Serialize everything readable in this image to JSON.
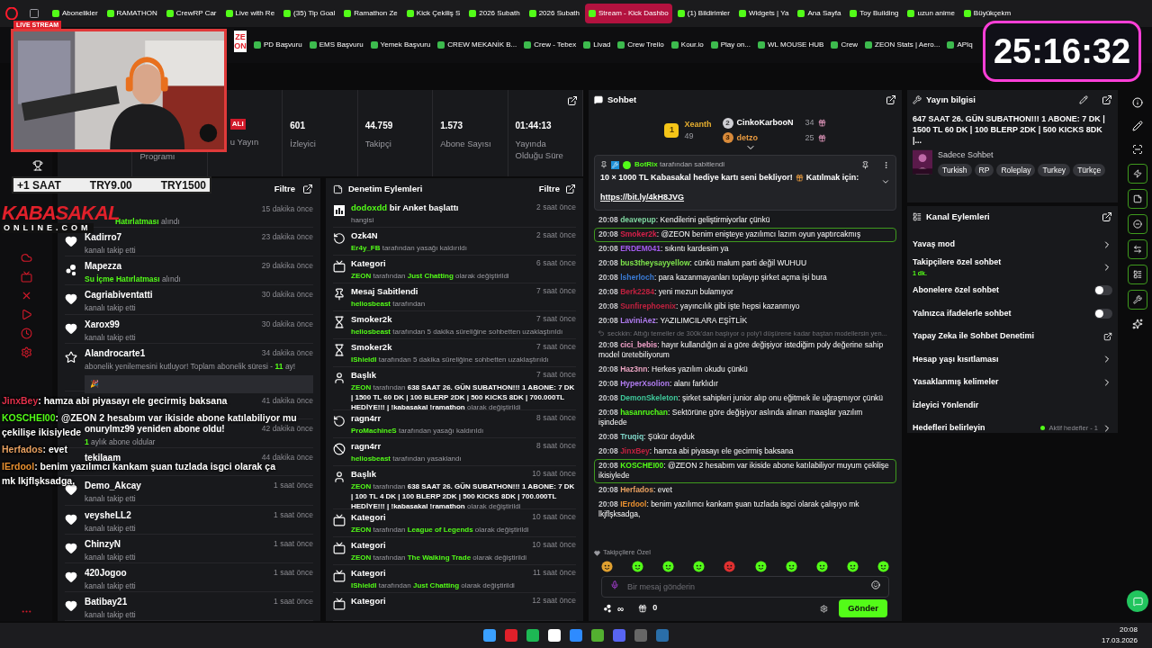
{
  "browser": {
    "tabs": [
      {
        "label": "Abonelikler",
        "selected": false
      },
      {
        "label": "RAMATHON",
        "selected": false
      },
      {
        "label": "CrewRP Car",
        "selected": false
      },
      {
        "label": "Live with Re",
        "selected": false
      },
      {
        "label": "(35) Tip Goal",
        "selected": false
      },
      {
        "label": "Ramathon Ze",
        "selected": false
      },
      {
        "label": "Kick Çekiliş S",
        "selected": false
      },
      {
        "label": "2026 Subath",
        "selected": false
      },
      {
        "label": "2026 Subath",
        "selected": false
      },
      {
        "label": "Stream - Kick Dashbo",
        "selected": true
      },
      {
        "label": "(1) Bildirimler",
        "selected": false
      },
      {
        "label": "Widgets | Ya",
        "selected": false
      },
      {
        "label": "Ana Sayfa",
        "selected": false
      },
      {
        "label": "Toy Building",
        "selected": false
      },
      {
        "label": "uzun anime",
        "selected": false
      },
      {
        "label": "Büyükçekm",
        "selected": false
      }
    ],
    "bookmarks": [
      "PD Başvuru",
      "EMS Başvuru",
      "Yemek Başvuru",
      "CREW MEKANİK B...",
      "Crew - Tebex",
      "Livad",
      "Crew Trello",
      "Kour.io",
      "Play on...",
      "WL MOUSE HUB",
      "Crew",
      "ZEON Stats | Aero...",
      "APIq"
    ]
  },
  "overlay": {
    "camera_badge": "LIVE STREAM",
    "camera_side_text": "ZEON",
    "timer": "25:16:32",
    "ticker": [
      "+1 SAAT",
      "TRY9.00",
      "TRY1500"
    ],
    "logo_top": "KABASAKAL",
    "logo_bottom": "ONLINE.COM",
    "chat": [
      {
        "user": "JinxBey",
        "color": "#e0304a",
        "lines": [
          ": hamza abi piyasayı ele gecirmiş baksana"
        ]
      },
      {
        "user": "KOSCHEI00",
        "color": "#53fc18",
        "lines": [
          ": @ZEON 2 hesabım var ikiside abone katılabiliyor mu",
          "çekilişe ikisiylede"
        ]
      },
      {
        "user": "Herfados",
        "color": "#e8a060",
        "lines": [
          ": evet"
        ]
      },
      {
        "user": "IErdool",
        "color": "#e89030",
        "lines": [
          ": benim yazılımcı kankam şuan tuzlada isgci olarak ça",
          "mk lkjflşksadga,"
        ]
      }
    ]
  },
  "stats": [
    {
      "label": "Programı"
    },
    {
      "badge": "ALI",
      "label": "u Yayın"
    },
    {
      "value": "601",
      "label": "İzleyici"
    },
    {
      "value": "44.759",
      "label": "Takipçi"
    },
    {
      "value": "1.573",
      "label": "Abone Sayısı"
    },
    {
      "value": "01:44:13",
      "label": "Yayında Olduğu Süre"
    }
  ],
  "activity": {
    "filter": "Filtre",
    "items": [
      {
        "time": "15 dakika önce",
        "text": [
          {
            "text": "Hatırlatması",
            "kind": "user"
          },
          {
            "text": " alındı",
            "kind": "plain"
          }
        ]
      },
      {
        "kind": "follow",
        "name": "Kadirro7",
        "time": "23 dakika önce",
        "text": [
          {
            "text": "kanalı takip etti",
            "kind": "plain"
          }
        ]
      },
      {
        "kind": "points",
        "name": "Mapezza",
        "time": "29 dakika önce",
        "text": [
          {
            "text": "Su İçme Hatırlatması",
            "kind": "user"
          },
          {
            "text": " alındı",
            "kind": "plain"
          }
        ]
      },
      {
        "kind": "follow",
        "name": "Cagriabiventatti",
        "time": "30 dakika önce",
        "text": [
          {
            "text": "kanalı takip etti",
            "kind": "plain"
          }
        ]
      },
      {
        "kind": "follow",
        "name": "Xarox99",
        "time": "30 dakika önce",
        "text": [
          {
            "text": "kanalı takip etti",
            "kind": "plain"
          }
        ]
      },
      {
        "kind": "resub",
        "name": "Alandrocarte1",
        "time": "34 dakika önce",
        "text": [
          {
            "text": "abonelik yenilemesini kutluyor! Toplam abonelik süresi - ",
            "kind": "plain"
          },
          {
            "text": "11",
            "kind": "user"
          },
          {
            "text": " ay!",
            "kind": "plain"
          }
        ],
        "message": "🎉"
      },
      {
        "time": "41 dakika önce"
      },
      {
        "time": "42 dakika önce",
        "name": "onurylmz99 yeniden abone oldu!",
        "text": [
          {
            "text": "1",
            "kind": "user"
          },
          {
            "text": " aylık abone oldular",
            "kind": "plain"
          }
        ]
      },
      {
        "name": "tekilaam",
        "time": "44 dakika önce"
      },
      {
        "kind": "follow",
        "name": "Demo_Akcay",
        "time": "1 saat önce",
        "text": [
          {
            "text": "kanalı takip etti",
            "kind": "plain"
          }
        ]
      },
      {
        "kind": "follow",
        "name": "veysheLL2",
        "time": "1 saat önce",
        "text": [
          {
            "text": "kanalı takip etti",
            "kind": "plain"
          }
        ]
      },
      {
        "kind": "follow",
        "name": "ChinzyN",
        "time": "1 saat önce",
        "text": [
          {
            "text": "kanalı takip etti",
            "kind": "plain"
          }
        ]
      },
      {
        "kind": "follow",
        "name": "420Jogoo",
        "time": "1 saat önce",
        "text": [
          {
            "text": "kanalı takip etti",
            "kind": "plain"
          }
        ]
      },
      {
        "kind": "follow",
        "name": "Batibay21",
        "time": "1 saat önce",
        "text": [
          {
            "text": "kanalı takip etti",
            "kind": "plain"
          }
        ]
      }
    ]
  },
  "moderation": {
    "title": "Denetim Eylemleri",
    "filter": "Filtre",
    "items": [
      {
        "kind": "poll",
        "title": [
          {
            "text": "dodoxdd",
            "kind": "user"
          },
          {
            "text": " bir Anket başlattı",
            "kind": "bold"
          }
        ],
        "time": "2 saat önce",
        "text": [
          {
            "text": "hangisi",
            "kind": "plain"
          }
        ]
      },
      {
        "kind": "unban",
        "title": [
          {
            "text": "Ozk4N",
            "kind": "bold"
          }
        ],
        "time": "2 saat önce",
        "text": [
          {
            "text": "Er4y_FB",
            "kind": "user"
          },
          {
            "text": " tarafından yasağı kaldırıldı",
            "kind": "plain"
          }
        ]
      },
      {
        "kind": "category",
        "title": [
          {
            "text": "Kategori",
            "kind": "bold"
          }
        ],
        "time": "6 saat önce",
        "text": [
          {
            "text": "ZEON",
            "kind": "user"
          },
          {
            "text": " tarafından ",
            "kind": "plain"
          },
          {
            "text": "Just Chatting",
            "kind": "user"
          },
          {
            "text": " olarak değiştirildi",
            "kind": "plain"
          }
        ]
      },
      {
        "kind": "pin",
        "title": [
          {
            "text": "Mesaj Sabitlendi",
            "kind": "bold"
          }
        ],
        "time": "7 saat önce",
        "text": [
          {
            "text": "heliosbeast",
            "kind": "user"
          },
          {
            "text": " tarafından",
            "kind": "plain"
          }
        ]
      },
      {
        "kind": "timeout",
        "title": [
          {
            "text": "Smoker2k",
            "kind": "bold"
          }
        ],
        "time": "7 saat önce",
        "text": [
          {
            "text": "heliosbeast",
            "kind": "user"
          },
          {
            "text": " tarafından 5 dakika süreliğine sohbetten uzaklaştırıldı",
            "kind": "plain"
          }
        ]
      },
      {
        "kind": "timeout",
        "title": [
          {
            "text": "Smoker2k",
            "kind": "bold"
          }
        ],
        "time": "7 saat önce",
        "text": [
          {
            "text": "IShieldI",
            "kind": "user"
          },
          {
            "text": " tarafından 5 dakika süreliğine sohbetten uzaklaştırıldı",
            "kind": "plain"
          }
        ]
      },
      {
        "kind": "title",
        "title": [
          {
            "text": "Başlık",
            "kind": "bold"
          }
        ],
        "time": "7 saat önce",
        "text": [
          {
            "text": "ZEON",
            "kind": "user"
          },
          {
            "text": " tarafından ",
            "kind": "plain"
          },
          {
            "text": "638 SAAT 26. GÜN SUBATHON!!! 1 ABONE: 7 DK | 1500 TL 60 DK | 100 BLERP 2DK | 500 KICKS 8DK | 700.000TL HEDİYE!!! | !kabasakal !ramathon",
            "kind": "bold"
          },
          {
            "text": " olarak değiştirildi",
            "kind": "plain"
          }
        ]
      },
      {
        "kind": "unban",
        "title": [
          {
            "text": "ragn4rr",
            "kind": "bold"
          }
        ],
        "time": "8 saat önce",
        "text": [
          {
            "text": "ProMachineS",
            "kind": "user"
          },
          {
            "text": " tarafından yasağı kaldırıldı",
            "kind": "plain"
          }
        ]
      },
      {
        "kind": "ban",
        "title": [
          {
            "text": "ragn4rr",
            "kind": "bold"
          }
        ],
        "time": "8 saat önce",
        "text": [
          {
            "text": "heliosbeast",
            "kind": "user"
          },
          {
            "text": " tarafından yasaklandı",
            "kind": "plain"
          }
        ]
      },
      {
        "kind": "title",
        "title": [
          {
            "text": "Başlık",
            "kind": "bold"
          }
        ],
        "time": "10 saat önce",
        "text": [
          {
            "text": "ZEON",
            "kind": "user"
          },
          {
            "text": " tarafından ",
            "kind": "plain"
          },
          {
            "text": "638 SAAT 26. GÜN SUBATHON!!! 1 ABONE: 7 DK | 100 TL 4 DK | 100 BLERP 2DK | 500 KICKS 8DK | 700.000TL HEDİYE!!! | !kabasakal !ramathon",
            "kind": "bold"
          },
          {
            "text": " olarak değiştirildi",
            "kind": "plain"
          }
        ]
      },
      {
        "kind": "category",
        "title": [
          {
            "text": "Kategori",
            "kind": "bold"
          }
        ],
        "time": "10 saat önce",
        "text": [
          {
            "text": "ZEON",
            "kind": "user"
          },
          {
            "text": " tarafından ",
            "kind": "plain"
          },
          {
            "text": "League of Legends",
            "kind": "user"
          },
          {
            "text": " olarak değiştirildi",
            "kind": "plain"
          }
        ]
      },
      {
        "kind": "category",
        "title": [
          {
            "text": "Kategori",
            "kind": "bold"
          }
        ],
        "time": "10 saat önce",
        "text": [
          {
            "text": "ZEON",
            "kind": "user"
          },
          {
            "text": " tarafından ",
            "kind": "plain"
          },
          {
            "text": "The Walking Trade",
            "kind": "user"
          },
          {
            "text": " olarak değiştirildi",
            "kind": "plain"
          }
        ]
      },
      {
        "kind": "category",
        "title": [
          {
            "text": "Kategori",
            "kind": "bold"
          }
        ],
        "time": "11 saat önce",
        "text": [
          {
            "text": "IShieldI",
            "kind": "user"
          },
          {
            "text": " tarafından ",
            "kind": "plain"
          },
          {
            "text": "Just Chatting",
            "kind": "user"
          },
          {
            "text": " olarak değiştirildi",
            "kind": "plain"
          }
        ]
      },
      {
        "kind": "category",
        "title": [
          {
            "text": "Kategori",
            "kind": "bold"
          }
        ],
        "time": "12 saat önce"
      }
    ]
  },
  "chat": {
    "title": "Sohbet",
    "leaders": [
      {
        "rank": "1",
        "name": "Xeanth",
        "count": "49"
      },
      {
        "rank": "2",
        "name": "CinkoKarbooN",
        "count": "34"
      },
      {
        "rank": "3",
        "name": "detzo",
        "count": "25"
      }
    ],
    "pinned": {
      "by": "BotRix",
      "by_suffix": "tarafından sabitlendi",
      "text": "10 × 1000 TL Kabasakal hediye kartı seni bekliyor!",
      "text2": "Katılmak için:",
      "link": "https://bit.ly/4kH8JVG"
    },
    "messages": [
      {
        "kind": "message",
        "time": "20:08",
        "user": "deavepup",
        "color": "#7fd6a0",
        "text": ": Kendilerini geliştirmiyorlar çünkü",
        "highlighted": false
      },
      {
        "kind": "message",
        "time": "20:08",
        "user": "Smoker2k",
        "color": "#d6204a",
        "text": ": @ZEON benim enişteye yazılımcı lazım oyun yaptırcakmış",
        "highlighted": true
      },
      {
        "kind": "message",
        "time": "20:08",
        "user": "ERDEM041",
        "color": "#a55cf0",
        "text": ": sıkıntı kardesim ya",
        "highlighted": false
      },
      {
        "kind": "message",
        "time": "20:08",
        "user": "bus3theysayyellow",
        "color": "#7de34b",
        "text": ": cünkü malum parti değil WUHUU",
        "highlighted": false
      },
      {
        "kind": "message",
        "time": "20:08",
        "user": "lsherloch",
        "color": "#3a7bd5",
        "text": ": para kazanmayanları toplayıp şirket açma işi bura",
        "highlighted": false
      },
      {
        "kind": "message",
        "time": "20:08",
        "user": "Berk2284",
        "color": "#c0213f",
        "text": ": yeni mezun bulamıyor",
        "highlighted": false
      },
      {
        "kind": "message",
        "time": "20:08",
        "user": "Sunfirephoenix",
        "color": "#c0213f",
        "text": ": yayıncılık gibi işte hepsi kazanmıyo",
        "highlighted": false
      },
      {
        "kind": "message",
        "time": "20:08",
        "user": "LaviniAez",
        "color": "#b07cf0",
        "text": ": YAZILIMCILARA EŞİTLİK",
        "highlighted": false
      },
      {
        "kind": "reply",
        "text": "seckkin: Attığı temeller de 300k'dan başlıyor o poly'i düşürene kadar baştan modellersin yen..."
      },
      {
        "kind": "message",
        "time": "20:08",
        "user": "cici_bebis",
        "color": "#f0a0c8",
        "text": ": hayır kullandığın ai a göre değişiyor istediğim poly değerine sahip model üretebiliyorum",
        "highlighted": false
      },
      {
        "kind": "message",
        "time": "20:08",
        "user": "Haz3nn",
        "color": "#e8a3c0",
        "text": ": Herkes yazılım okudu çünkü",
        "highlighted": false
      },
      {
        "kind": "message",
        "time": "20:08",
        "user": "HyperXsolion",
        "color": "#b07cf0",
        "text": ": alanı farklıdır",
        "highlighted": false
      },
      {
        "kind": "message",
        "time": "20:08",
        "user": "DemonSkeleton",
        "color": "#3fc79a",
        "text": ": şirket sahipleri junior alıp onu eğitmek ile uğraşmıyor çünkü",
        "highlighted": false
      },
      {
        "kind": "message",
        "time": "20:08",
        "user": "hasanruchan",
        "color": "#53fc18",
        "text": ": Sektörüne göre değişiyor aslında alınan maaşlar yazılım işindede",
        "highlighted": false
      },
      {
        "kind": "message",
        "time": "20:08",
        "user": "Truqiq",
        "color": "#7fd6c8",
        "text": ": Şükür doyduk",
        "highlighted": false
      },
      {
        "kind": "message",
        "time": "20:08",
        "user": "JinxBey",
        "color": "#c0213f",
        "text": ": hamza abi piyasayı ele gecirmiş baksana",
        "highlighted": false
      },
      {
        "kind": "message",
        "time": "20:08",
        "user": "KOSCHEI00",
        "color": "#53fc18",
        "text": ": @ZEON 2 hesabım var ikiside abone katılabiliyor muyum çekilişe ikisiylede",
        "highlighted": true
      },
      {
        "kind": "message",
        "time": "20:08",
        "user": "Herfados",
        "color": "#e8a060",
        "text": ": evet",
        "highlighted": false
      },
      {
        "kind": "message",
        "time": "20:08",
        "user": "IErdool",
        "color": "#e89030",
        "text": ": benim yazılımcı kankam şuan tuzlada isgci olarak çalışıyo mk lkjflşksadga,",
        "highlighted": false
      }
    ],
    "emote_label": "Takipçilere Özel",
    "placeholder": "Bir mesaj gönderin",
    "points": "∞",
    "gifts": "0",
    "send": "Gönder"
  },
  "stream_info": {
    "title": "Yayın bilgisi",
    "stream_title": "647 SAAT 26. GÜN SUBATHON!!! 1 ABONE: 7 DK | 1500 TL 60 DK | 100 BLERP 2DK | 500 KICKS 8DK |...",
    "category": "Sadece Sohbet",
    "tags": [
      "Turkish",
      "RP",
      "Roleplay",
      "Turkey",
      "Türkçe"
    ]
  },
  "channel_actions": {
    "title": "Kanal Eylemleri",
    "items": [
      {
        "kind": "link",
        "label": "Yavaş mod"
      },
      {
        "kind": "link",
        "label": "Takipçilere özel sohbet",
        "detail": "1 dk."
      },
      {
        "kind": "toggle",
        "label": "Abonelere özel sohbet",
        "on": false
      },
      {
        "kind": "toggle",
        "label": "Yalnızca ifadelerle sohbet",
        "on": false
      },
      {
        "kind": "external",
        "label": "Yapay Zeka ile Sohbet Denetimi"
      },
      {
        "kind": "link",
        "label": "Hesap yaşı kısıtlaması"
      },
      {
        "kind": "link",
        "label": "Yasaklanmış kelimeler"
      },
      {
        "kind": "plain",
        "label": "İzleyici Yönlendir"
      },
      {
        "kind": "link",
        "label": "Hedefleri belirleyin",
        "status": "Aktif hedefler - 1"
      }
    ]
  },
  "taskbar": {
    "time": "20:08",
    "date": "17.03.2026"
  }
}
